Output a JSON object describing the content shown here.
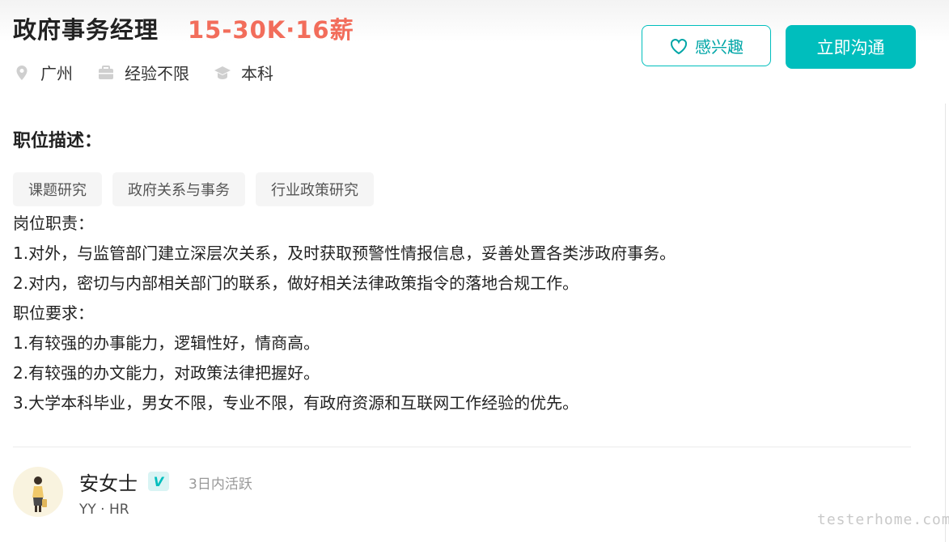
{
  "job": {
    "title": "政府事务经理",
    "salary": "15-30K·16薪",
    "location": "广州",
    "experience": "经验不限",
    "education": "本科"
  },
  "actions": {
    "interest_label": "感兴趣",
    "chat_label": "立即沟通"
  },
  "description": {
    "section_title": "职位描述：",
    "tags": [
      "课题研究",
      "政府关系与事务",
      "行业政策研究"
    ],
    "lines": [
      "岗位职责：",
      "1.对外，与监管部门建立深层次关系，及时获取预警性情报信息，妥善处置各类涉政府事务。",
      "2.对内，密切与内部相关部门的联系，做好相关法律政策指令的落地合规工作。",
      "职位要求：",
      "1.有较强的办事能力，逻辑性好，情商高。",
      "2.有较强的办文能力，对政策法律把握好。",
      "3.大学本科毕业，男女不限，专业不限，有政府资源和互联网工作经验的优先。"
    ]
  },
  "recruiter": {
    "name": "安女士",
    "badge": "V",
    "active_status": "3日内活跃",
    "company_role": "YY · HR"
  },
  "watermark": "testerhome.com",
  "colors": {
    "accent": "#00bebd",
    "salary": "#f26d5b"
  },
  "icons": {
    "location": "location-pin-icon",
    "experience": "briefcase-icon",
    "education": "graduation-cap-icon",
    "interest": "heart-icon"
  }
}
